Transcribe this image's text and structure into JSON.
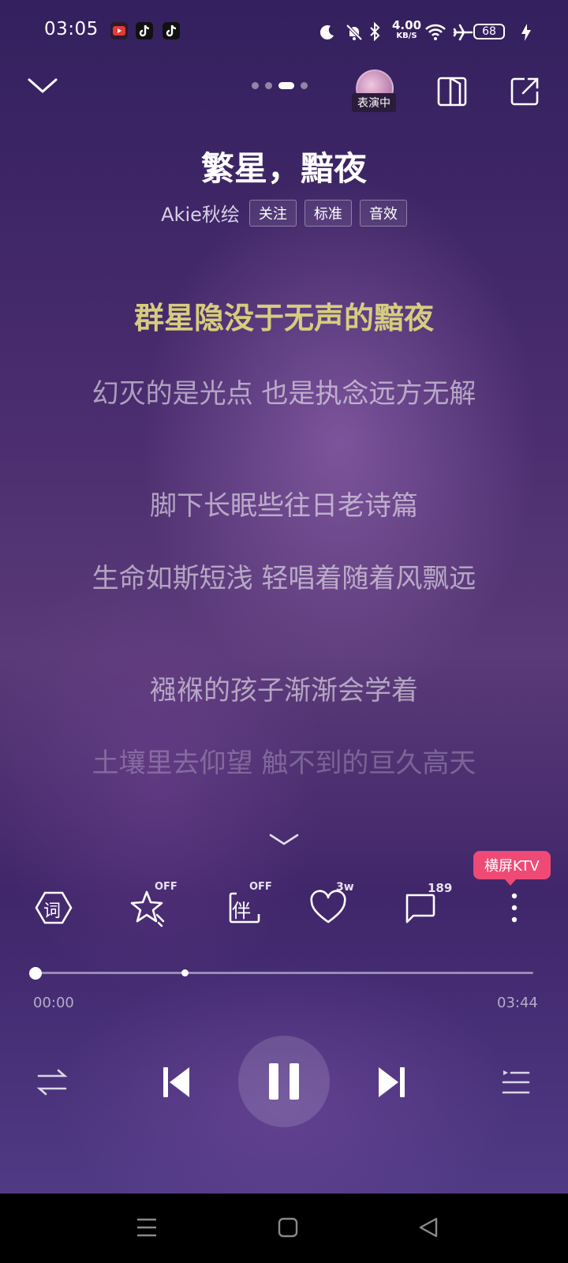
{
  "status_bar": {
    "time": "03:05",
    "net_speed_value": "4.00",
    "net_speed_unit": "KB/S",
    "battery": "68",
    "icons": [
      "video-app-icon",
      "tiktok-icon",
      "tiktok-icon",
      "moon-icon",
      "bell-muted-icon",
      "bluetooth-icon",
      "wifi-icon",
      "airplane-icon",
      "battery-icon",
      "charging-icon"
    ]
  },
  "header": {
    "page_dots": 4,
    "active_dot": 2,
    "avatar_badge": "表演中"
  },
  "song": {
    "title": "繁星，黯夜",
    "artist": "Akie秋绘",
    "tags": [
      "关注",
      "标准",
      "音效"
    ]
  },
  "lyrics": [
    {
      "text": "群星隐没于无声的黯夜",
      "state": "current"
    },
    {
      "text": "幻灭的是光点 也是执念远方无解",
      "state": "normal"
    },
    {
      "text": "脚下长眠些往日老诗篇",
      "state": "normal"
    },
    {
      "text": "生命如斯短浅 轻唱着随着风飘远",
      "state": "normal"
    },
    {
      "text": "襁褓的孩子渐渐会学着",
      "state": "normal"
    },
    {
      "text": "土壤里去仰望 触不到的亘久高天",
      "state": "faded"
    }
  ],
  "actions": {
    "lyrics_label": "词",
    "effect_badge": "OFF",
    "accompany_label": "伴",
    "accompany_badge": "OFF",
    "like_count": "3w",
    "comment_count": "189",
    "ktv_label": "横屏KTV"
  },
  "progress": {
    "current": "00:00",
    "total": "03:44",
    "fraction": 0.0,
    "buffered_marker_fraction": 0.3
  },
  "colors": {
    "current_lyric": "#d7cc7e",
    "ktv_badge": "#ef4a76"
  }
}
